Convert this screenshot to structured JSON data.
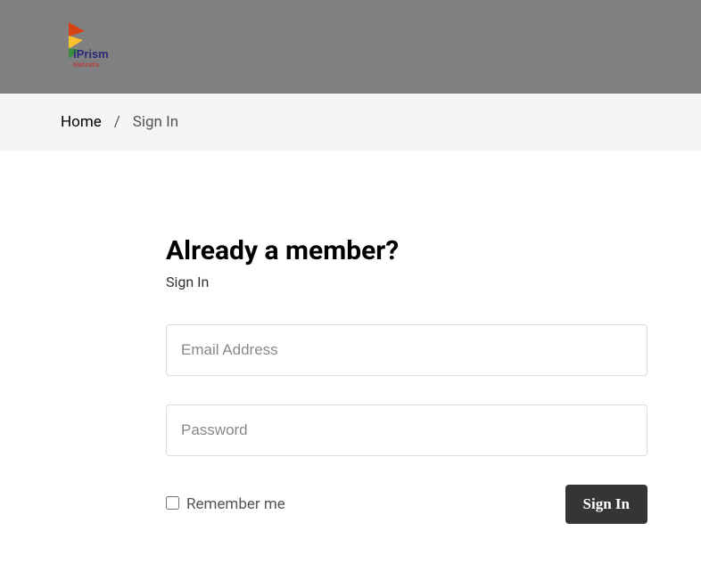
{
  "logo": {
    "brand_text": "iPrism",
    "brand_subtext": "Mahindra"
  },
  "breadcrumb": {
    "home": "Home",
    "separator": "/",
    "current": "Sign In"
  },
  "form": {
    "heading": "Already a member?",
    "subheading": "Sign In",
    "email_placeholder": "Email Address",
    "password_placeholder": "Password",
    "remember_label": "Remember me",
    "submit_label": "Sign In"
  }
}
